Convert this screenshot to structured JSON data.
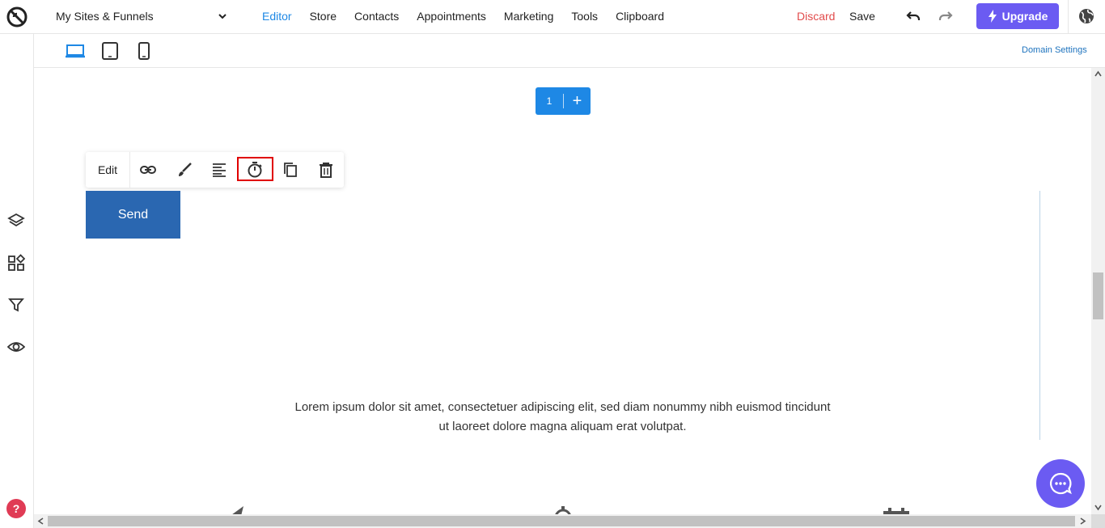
{
  "header": {
    "site_selector": "My Sites & Funnels",
    "nav": [
      "Editor",
      "Store",
      "Contacts",
      "Appointments",
      "Marketing",
      "Tools",
      "Clipboard"
    ],
    "active_nav": "Editor",
    "discard_label": "Discard",
    "save_label": "Save",
    "upgrade_label": "Upgrade"
  },
  "device_bar": {
    "devices": [
      "desktop-icon",
      "tablet-icon",
      "mobile-icon"
    ],
    "active_device": "desktop",
    "domain_settings_label": "Domain Settings"
  },
  "left_sidebar": {
    "icons": [
      "layers-icon",
      "widgets-icon",
      "filter-icon",
      "eye-icon"
    ],
    "help_label": "?"
  },
  "canvas": {
    "page_number": "1",
    "add_page_label": "+",
    "toolbar": {
      "edit_label": "Edit",
      "icons": [
        "link-icon",
        "brush-icon",
        "align-left-icon",
        "timer-icon",
        "duplicate-icon",
        "delete-icon"
      ],
      "highlighted": "timer-icon"
    },
    "send_button_label": "Send",
    "lorem_line1": "Lorem ipsum dolor sit amet, consectetuer adipiscing elit, sed diam nonummy nibh euismod tincidunt",
    "lorem_line2": "ut laoreet dolore magna aliquam erat volutpat."
  },
  "colors": {
    "accent": "#1e88e5",
    "upgrade": "#6b5bf2",
    "discard": "#e24c4c",
    "send_button": "#2a67b1",
    "highlight": "#e00000"
  }
}
